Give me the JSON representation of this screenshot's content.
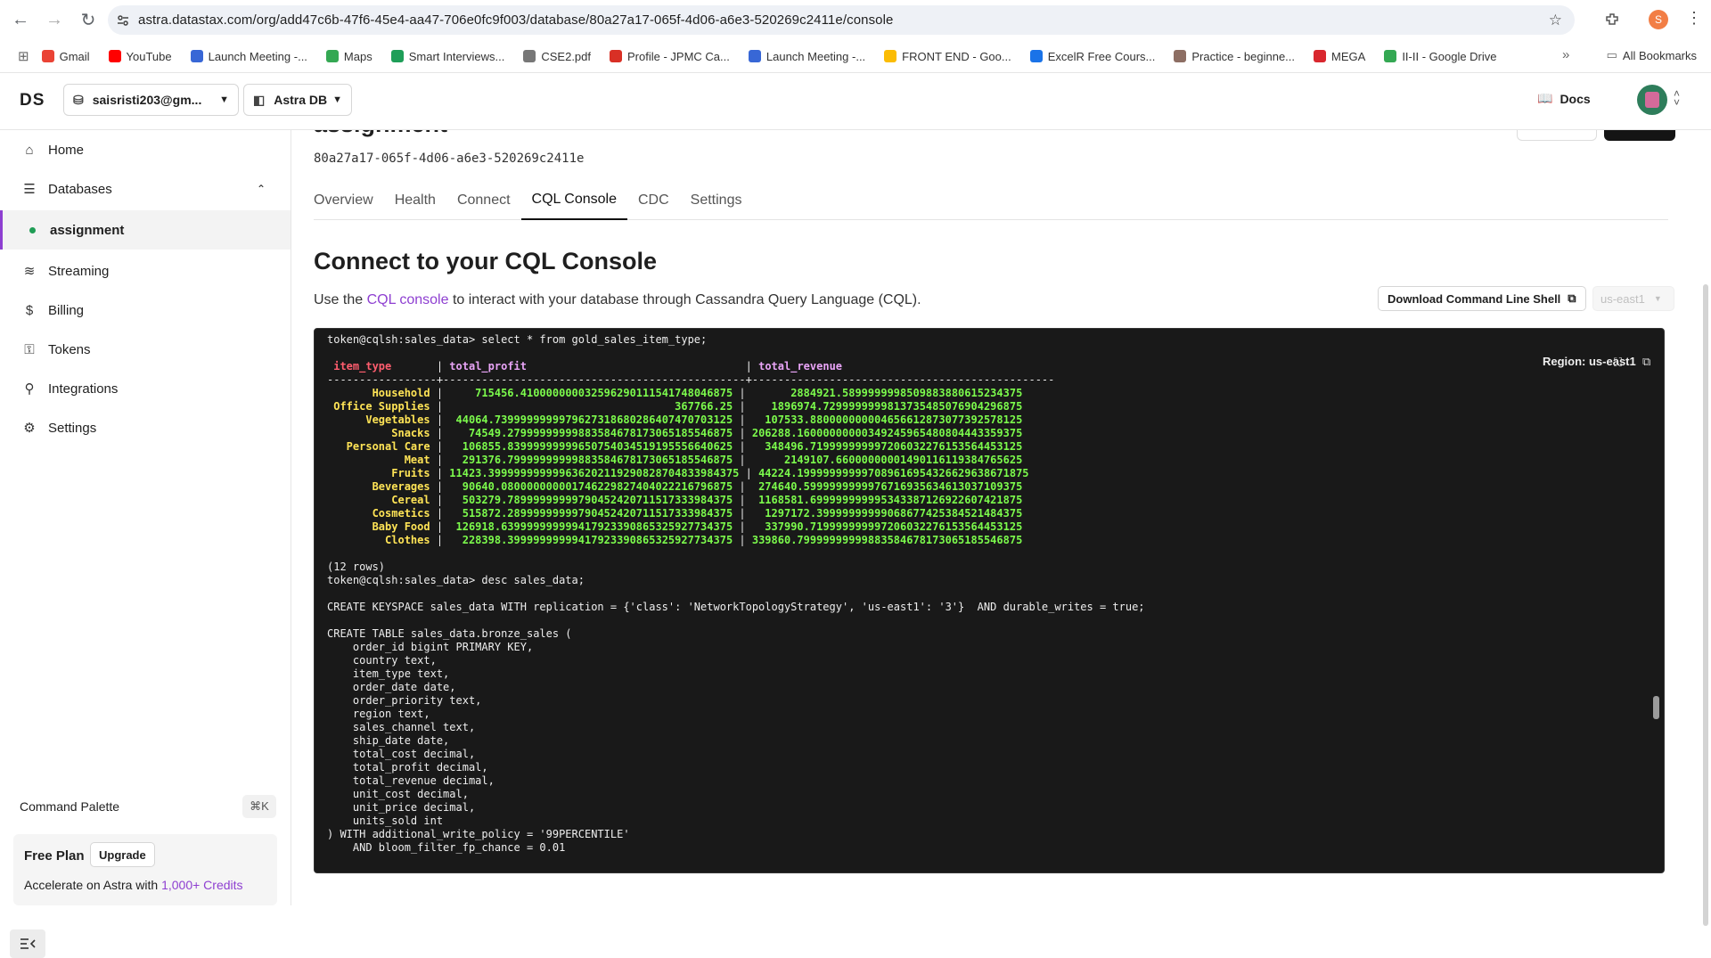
{
  "browser": {
    "url": "astra.datastax.com/org/add47c6b-47f6-45e4-aa47-706e0fc9f003/database/80a27a17-065f-4d06-a6e3-520269c2411e/console",
    "profile_initial": "S",
    "bookmarks": [
      {
        "label": "Gmail",
        "color": "#ea4335"
      },
      {
        "label": "YouTube",
        "color": "#ff0000"
      },
      {
        "label": "Launch Meeting -...",
        "color": "#3867d6"
      },
      {
        "label": "Maps",
        "color": "#34a853"
      },
      {
        "label": "Smart Interviews...",
        "color": "#1e9e58"
      },
      {
        "label": "CSE2.pdf",
        "color": "#777777"
      },
      {
        "label": "Profile - JPMC Ca...",
        "color": "#d93025"
      },
      {
        "label": "Launch Meeting -...",
        "color": "#3867d6"
      },
      {
        "label": "FRONT END - Goo...",
        "color": "#fbbc04"
      },
      {
        "label": "ExcelR Free Cours...",
        "color": "#1a73e8"
      },
      {
        "label": "Practice - beginne...",
        "color": "#8d6e63"
      },
      {
        "label": "MEGA",
        "color": "#d9272e"
      },
      {
        "label": "II-II - Google Drive",
        "color": "#34a853"
      }
    ],
    "all_bookmarks": "All Bookmarks"
  },
  "header": {
    "logo": "DS",
    "org": "saisristi203@gm...",
    "product": "Astra DB",
    "docs": "Docs"
  },
  "sidebar": {
    "items": [
      {
        "label": "Home",
        "icon": "home-icon"
      },
      {
        "label": "Databases",
        "icon": "database-icon"
      },
      {
        "label": "assignment",
        "icon": "status-dot"
      },
      {
        "label": "Streaming",
        "icon": "streaming-icon"
      },
      {
        "label": "Billing",
        "icon": "billing-icon"
      },
      {
        "label": "Tokens",
        "icon": "key-icon"
      },
      {
        "label": "Integrations",
        "icon": "plug-icon"
      },
      {
        "label": "Settings",
        "icon": "gear-icon"
      }
    ],
    "command_palette": "Command Palette",
    "shortcut": "⌘K",
    "free_plan": "Free Plan",
    "upgrade": "Upgrade",
    "accelerate_prefix": "Accelerate on Astra with ",
    "accelerate_link": "1,000+ Credits"
  },
  "main": {
    "title": "assignment",
    "db_id": "80a27a17-065f-4d06-a6e3-520269c2411e",
    "tabs": [
      "Overview",
      "Health",
      "Connect",
      "CQL Console",
      "CDC",
      "Settings"
    ],
    "active_tab": "CQL Console",
    "heading": "Connect to your CQL Console",
    "subtitle_prefix": "Use the ",
    "subtitle_link": "CQL console",
    "subtitle_suffix": " to interact with your database through Cassandra Query Language (CQL).",
    "download_button": "Download Command Line Shell",
    "region_select": "us-east1",
    "region_label": "Region: us-east1"
  },
  "console": {
    "prompt1": "token@cqlsh:sales_data> select * from gold_sales_item_type;",
    "col_item_type": "item_type",
    "col_total_profit": "total_profit",
    "col_total_revenue": "total_revenue",
    "separator": "-----------------+-----------------------------------------------+-----------------------------------------------",
    "rows": [
      {
        "item": "Household",
        "profit": "715456.41000000003259629011154174804687 5",
        "revenue": "2884921.58999999985098838806152343 75"
      },
      {
        "item": "Office Supplies",
        "profit": "367766.25",
        "revenue": "1896974.72999999998137354850769042968 75"
      },
      {
        "item": "Vegetables",
        "profit": "44064.73999999999796273186802864074707031 25",
        "revenue": "107533.88000000000465661287307739257812 5"
      },
      {
        "item": "Snacks",
        "profit": "74549.27999999999883584678173065185546875",
        "revenue": "206288.16000000000349245965480804443359375"
      },
      {
        "item": "Personal Care",
        "profit": "106855.83999999999650754034519195556640625",
        "revenue": "348496.71999999999720603227615356445312 5"
      },
      {
        "item": "Meat",
        "profit": "291376.79999999999883584678173065185546875",
        "revenue": "2149107.6600000000149011611938476562 5"
      },
      {
        "item": "Fruits",
        "profit": "11423.39999999999963620211929082870483398437 5",
        "revenue": "44224.19999999999708961695432662963867187 5"
      },
      {
        "item": "Beverages",
        "profit": "90640.08000000000174622982740402221679687 5",
        "revenue": "274640.59999999999767169356346130371093 75"
      },
      {
        "item": "Cereal",
        "profit": "503279.78999999999790452420711517333984375",
        "revenue": "1168581.69999999999534338712692260742187 5"
      },
      {
        "item": "Cosmetics",
        "profit": "515872.28999999999790452420711517333984375",
        "revenue": "1297172.39999999999068677425384521484375"
      },
      {
        "item": "Baby Food",
        "profit": "126918.63999999999941792339086532592773437 5",
        "revenue": "337990.71999999999720603227615356445312 5"
      },
      {
        "item": "Clothes",
        "profit": "228398.39999999999417923390865325927734375",
        "revenue": "339860.79999999999883584678173065185546875"
      }
    ],
    "rowcount": "(12 rows)",
    "prompt2": "token@cqlsh:sales_data> desc sales_data;",
    "keyspace": "CREATE KEYSPACE sales_data WITH replication = {'class': 'NetworkTopologyStrategy', 'us-east1': '3'}  AND durable_writes = true;",
    "table_lines": [
      "CREATE TABLE sales_data.bronze_sales (",
      "    order_id bigint PRIMARY KEY,",
      "    country text,",
      "    item_type text,",
      "    order_date date,",
      "    order_priority text,",
      "    region text,",
      "    sales_channel text,",
      "    ship_date date,",
      "    total_cost decimal,",
      "    total_profit decimal,",
      "    total_revenue decimal,",
      "    unit_cost decimal,",
      "    unit_price decimal,",
      "    units_sold int",
      ") WITH additional_write_policy = '99PERCENTILE'",
      "    AND bloom_filter_fp_chance = 0.01"
    ]
  }
}
